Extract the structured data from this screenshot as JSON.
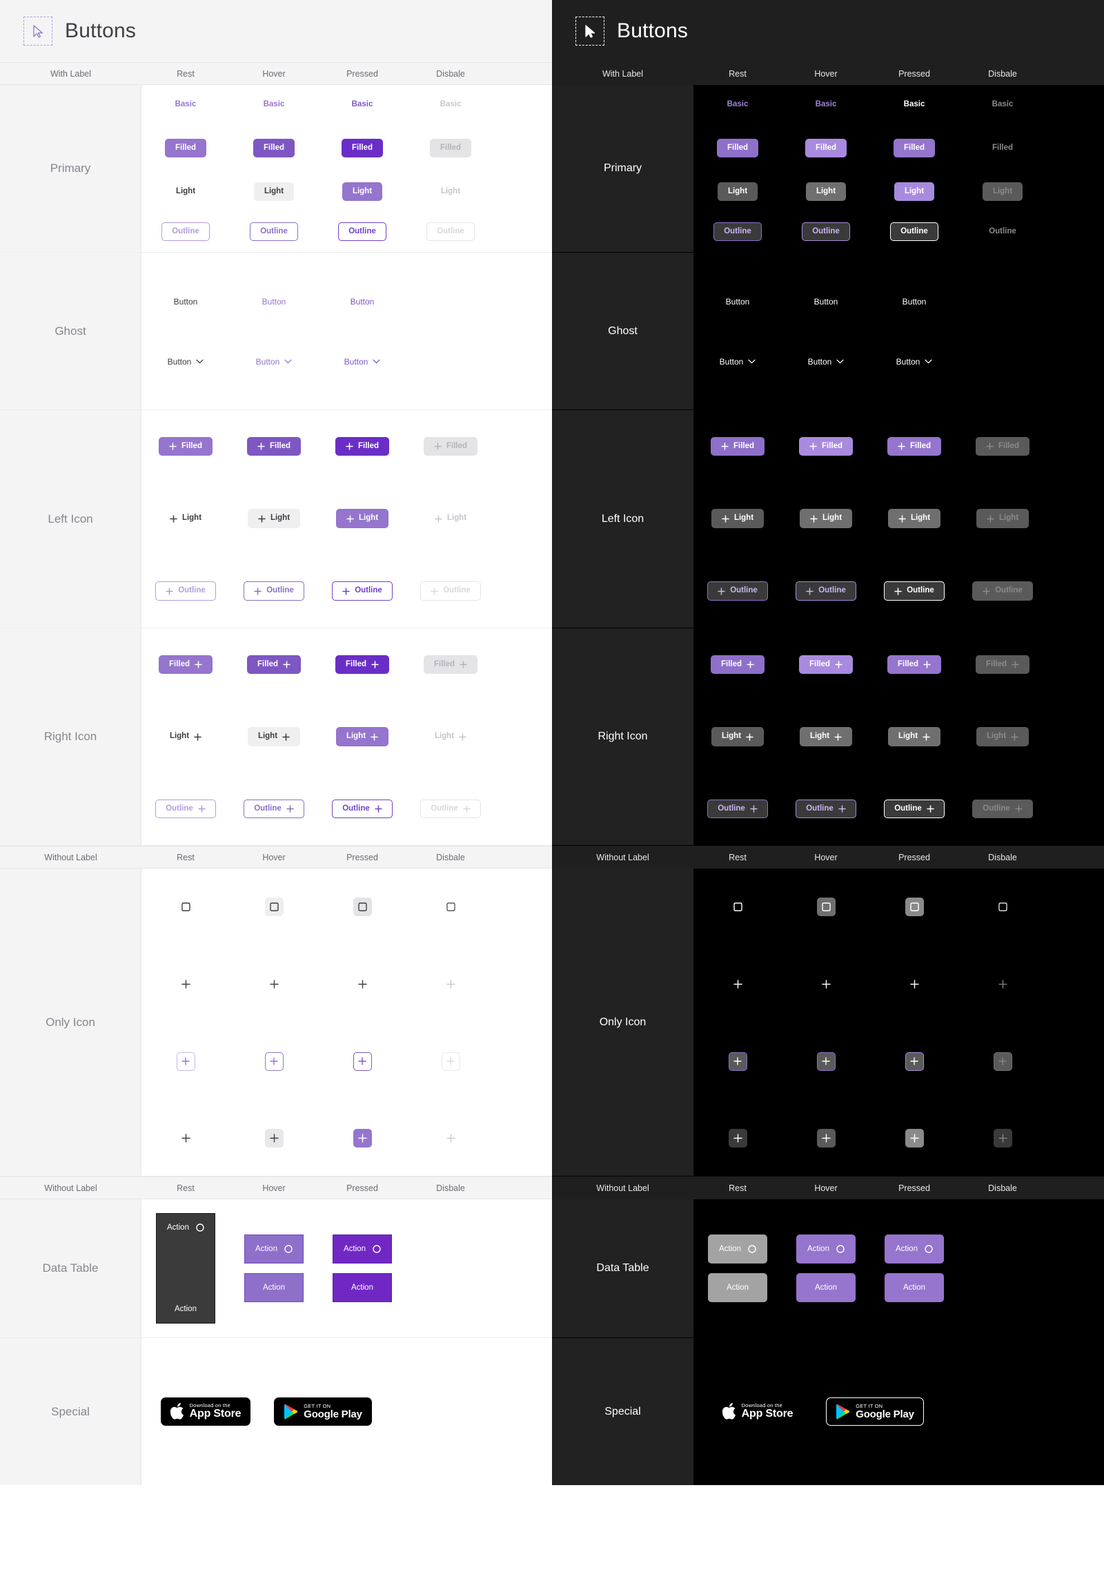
{
  "title": "Buttons",
  "cursor_icon": "cursor-arrow-icon",
  "colors": {
    "accent": "#9575cd",
    "accent_hover": "#7e57c2",
    "accent_pressed": "#6a2ec7",
    "accent_light_dark": "#a88ade",
    "disabled_light": "#c9c9ce",
    "disabled_dark": "#8a8a8a",
    "panel_light_bg": "#f4f4f5",
    "panel_dark_bg": "#1f1f1f",
    "content_light_bg": "#ffffff",
    "content_dark_bg": "#000000"
  },
  "headers": {
    "with_label": "With Label",
    "without_label": "Without Label",
    "states": [
      "Rest",
      "Hover",
      "Pressed",
      "Disbale"
    ]
  },
  "rows": {
    "primary": "Primary",
    "ghost": "Ghost",
    "left_icon": "Left Icon",
    "right_icon": "Right Icon",
    "only_icon": "Only Icon",
    "data_table": "Data Table",
    "special": "Special"
  },
  "labels": {
    "basic": "Basic",
    "filled": "Filled",
    "light": "Light",
    "outline": "Outline",
    "button": "Button",
    "action": "Action"
  },
  "icons": {
    "plus": "plus-icon",
    "chevron_down": "chevron-down-icon",
    "square": "square-icon",
    "circle": "circle-icon"
  },
  "store": {
    "apple": {
      "top": "Download on the",
      "name": "App Store",
      "icon": "apple-logo-icon"
    },
    "google": {
      "top": "GET IT ON",
      "name": "Google Play",
      "icon": "google-play-icon"
    }
  }
}
